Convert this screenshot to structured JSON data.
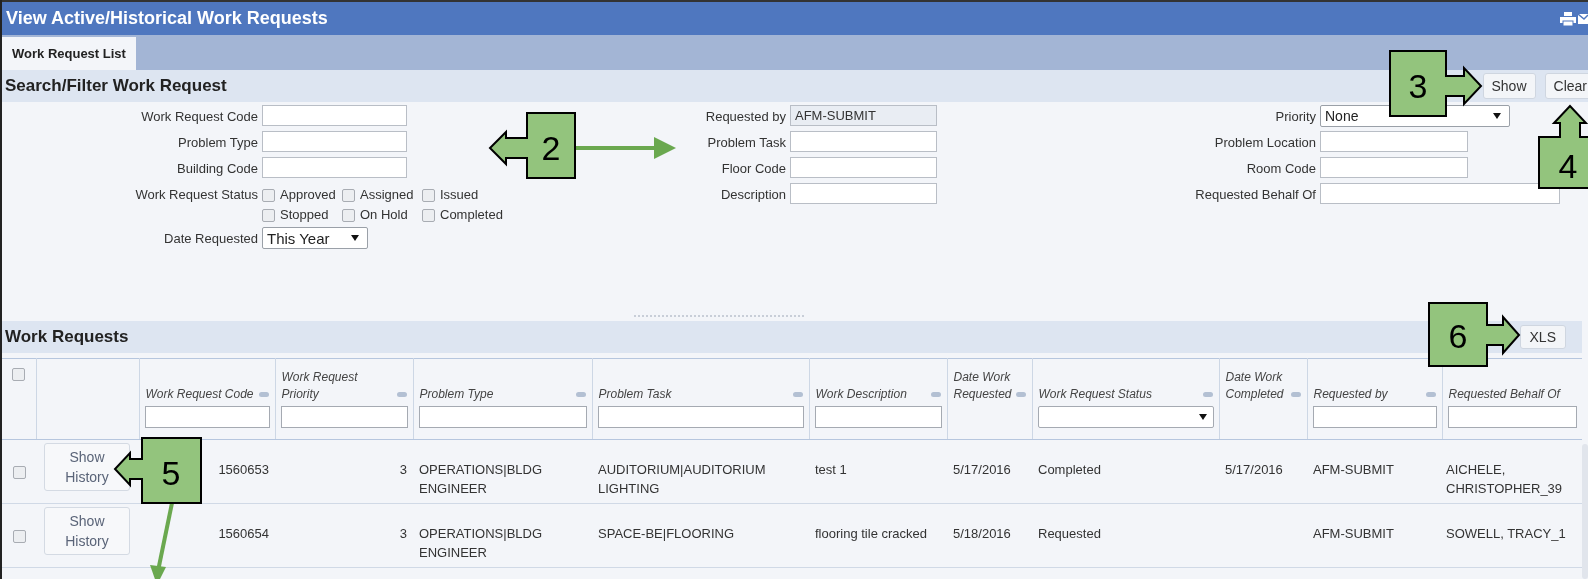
{
  "window": {
    "title": "View Active/Historical Work Requests"
  },
  "tabs": [
    {
      "label": "Work Request List",
      "selected": true
    }
  ],
  "filter_panel": {
    "title": "Search/Filter Work Request",
    "buttons": [
      "Show",
      "Clear"
    ],
    "columns": [
      [
        {
          "label": "Work Request Code",
          "kind": "text"
        },
        {
          "label": "Problem Type",
          "kind": "text"
        },
        {
          "label": "Building Code",
          "kind": "text"
        },
        {
          "label": "Work Request Status",
          "kind": "checks",
          "options": [
            {
              "label": "Approved",
              "checked": false
            },
            {
              "label": "Assigned",
              "checked": false
            },
            {
              "label": "Issued",
              "checked": false
            },
            {
              "label": "Stopped",
              "checked": false
            },
            {
              "label": "On Hold",
              "checked": false
            },
            {
              "label": "Completed",
              "checked": false
            }
          ]
        },
        {
          "label": "Date Requested",
          "kind": "select",
          "value": "This Year"
        }
      ],
      [
        {
          "label": "Requested by",
          "kind": "readonly",
          "value": "AFM-SUBMIT"
        },
        {
          "label": "Problem Task",
          "kind": "text"
        },
        {
          "label": "Floor Code",
          "kind": "text"
        },
        {
          "label": "Description",
          "kind": "text"
        }
      ],
      [
        {
          "label": "Priority",
          "kind": "select",
          "value": "None"
        },
        {
          "label": "Problem Location",
          "kind": "text"
        },
        {
          "label": "Room Code",
          "kind": "text"
        },
        {
          "label": "Requested Behalf Of",
          "kind": "text"
        }
      ]
    ]
  },
  "work_requests": {
    "title": "Work Requests",
    "export_button": "XLS",
    "select_all_checked": false,
    "columns": [
      {
        "label": "Work Request Code",
        "kind": "text",
        "sortable": true
      },
      {
        "label": "Work Request Priority",
        "kind": "text",
        "sortable": true
      },
      {
        "label": "Problem Type",
        "kind": "text",
        "sortable": true
      },
      {
        "label": "Problem Task",
        "kind": "text",
        "sortable": true
      },
      {
        "label": "Work Description",
        "kind": "text",
        "sortable": true
      },
      {
        "label": "Date Work Requested",
        "kind": "date",
        "sortable": true
      },
      {
        "label": "Work Request Status",
        "kind": "select",
        "sortable": true
      },
      {
        "label": "Date Work Completed",
        "kind": "date",
        "sortable": true
      },
      {
        "label": "Requested by",
        "kind": "text",
        "sortable": true
      },
      {
        "label": "Requested Behalf Of",
        "kind": "text",
        "sortable": false
      }
    ],
    "rows": [
      {
        "selected": false,
        "button": "Show History",
        "cells": [
          "1560653",
          "3",
          "OPERATIONS|BLDG ENGINEER",
          "AUDITORIUM|AUDITORIUM LIGHTING",
          "test 1",
          "5/17/2016",
          "Completed",
          "5/17/2016",
          "AFM-SUBMIT",
          "AICHELE, CHRISTOPHER_39"
        ]
      },
      {
        "selected": false,
        "button": "Show History",
        "cells": [
          "1560654",
          "3",
          "OPERATIONS|BLDG ENGINEER",
          "SPACE-BE|FLOORING",
          "flooring tile cracked",
          "5/18/2016",
          "Requested",
          null,
          "AFM-SUBMIT",
          "SOWELL, TRACY_1"
        ]
      }
    ]
  },
  "callouts": [
    {
      "label": "2"
    },
    {
      "label": "3"
    },
    {
      "label": "4"
    },
    {
      "label": "5"
    },
    {
      "label": "6"
    }
  ]
}
